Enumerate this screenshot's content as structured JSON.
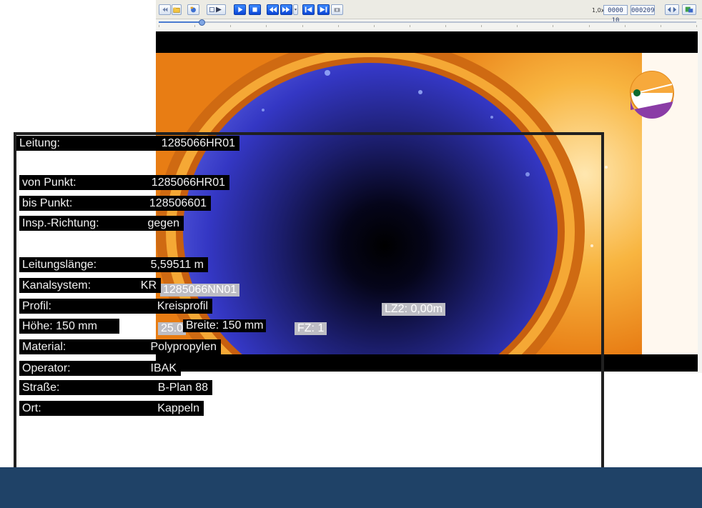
{
  "player": {
    "speed": "1,0x",
    "counter_a": "0000 10",
    "counter_b": "000209",
    "progress": 0.08
  },
  "osd": {
    "point_code": "1285066NN01",
    "lz2": "LZ2: 0,00m",
    "breite": "Breite: 150 mm",
    "fz": "FZ: 1",
    "partial": "25.0"
  },
  "info": {
    "leitung": {
      "label": "Leitung:",
      "value": "1285066HR01"
    },
    "von_punkt": {
      "label": "von Punkt:",
      "value": "1285066HR01"
    },
    "bis_punkt": {
      "label": "bis Punkt:",
      "value": "128506601"
    },
    "insp_richtung": {
      "label": "Insp.-Richtung:",
      "value": "gegen"
    },
    "leitungslaenge": {
      "label": "Leitungslänge:",
      "value": "5,59511 m"
    },
    "kanalsystem": {
      "label": "Kanalsystem:",
      "value": "KR"
    },
    "profil": {
      "label": "Profil:",
      "value": "Kreisprofil"
    },
    "hoehe": {
      "label": "Höhe: 150 mm"
    },
    "material": {
      "label": "Material:",
      "value": "Polypropylen"
    },
    "operator": {
      "label": "Operator:",
      "value": "IBAK"
    },
    "strasse": {
      "label": "Straße:",
      "value": "B-Plan 88"
    },
    "ort": {
      "label": "Ort:",
      "value": "Kappeln"
    }
  },
  "colors": {
    "pipe_inner": "#3b3fd0",
    "pipe_outer": "#f39a26",
    "band": "#1f4267"
  },
  "icons": [
    "rewind-icon",
    "folder-icon",
    "camera-icon",
    "play-icon",
    "stop-icon",
    "fast-rewind-icon",
    "fast-forward-icon",
    "skip-start-icon",
    "skip-end-icon",
    "snapshot-icon",
    "zoom-icon",
    "export-icon",
    "compass-icon"
  ]
}
